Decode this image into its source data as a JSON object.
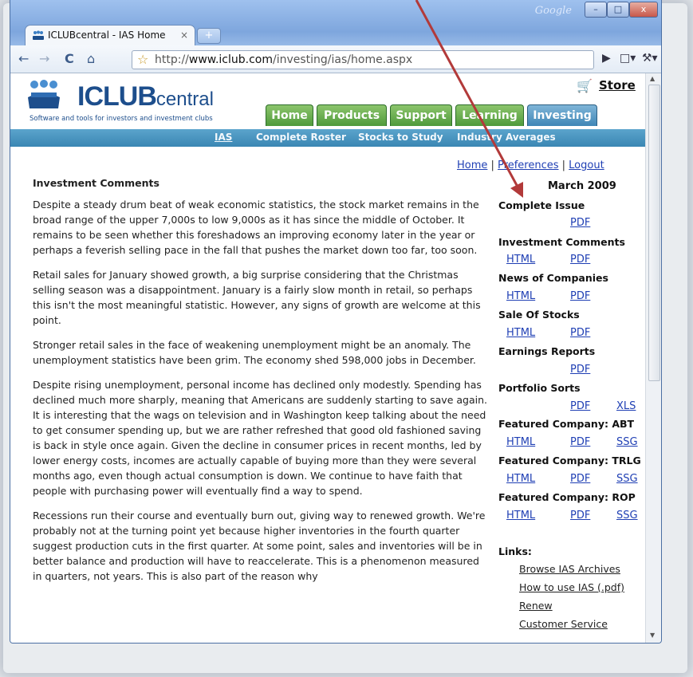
{
  "browser": {
    "watermark": "Google",
    "window_buttons": {
      "minimize": "–",
      "maximize": "□",
      "close": "x"
    },
    "tab": {
      "title": "ICLUBcentral - IAS Home",
      "close": "×",
      "favicon": "iclub-favicon-icon"
    },
    "new_tab": "+",
    "url_prefix": "http://",
    "url_domain": "www.iclub.com",
    "url_path": "/investing/ias/home.aspx",
    "nav_icons": [
      "back-icon",
      "forward-icon",
      "reload-icon",
      "home-icon",
      "bookmark-star-icon",
      "go-icon",
      "page-menu-icon",
      "wrench-menu-icon"
    ]
  },
  "site": {
    "logo_bold": "ICLUB",
    "logo_rest": "central",
    "tagline": "Software and tools for investors and investment clubs",
    "store": "Store",
    "nav_tabs": [
      "Home",
      "Products",
      "Support",
      "Learning",
      "Investing"
    ],
    "active_tab": "Investing",
    "subnav": [
      "IAS",
      "Complete Roster",
      "Stocks to Study",
      "Industry Averages"
    ],
    "toplinks": {
      "home": "Home",
      "sep1": " | ",
      "preferences": "Preferences",
      "sep2": " | ",
      "logout": "Logout"
    }
  },
  "article": {
    "heading": "Investment Comments",
    "paragraphs": [
      "Despite a steady drum beat of weak economic statistics, the stock market remains in the broad range of the upper 7,000s to low 9,000s as it has since the middle of October. It remains to be seen whether this foreshadows an improving economy later in the year or perhaps a feverish selling pace in the fall that pushes the market down too far, too soon.",
      "Retail sales for January showed growth, a big surprise considering that the Christmas selling season was a disappointment. January is a fairly slow month in retail, so perhaps this isn't the most meaningful statistic. However, any signs of growth are welcome at this point.",
      "Stronger retail sales in the face of weakening unemployment might be an anomaly. The unemployment statistics have been grim. The economy shed 598,000 jobs in December.",
      "Despite rising unemployment, personal income has declined only modestly. Spending has declined much more sharply, meaning that Americans are suddenly starting to save again. It is interesting that the wags on television and in Washington keep talking about the need to get consumer spending up, but we are rather refreshed that good old fashioned saving is back in style once again. Given the decline in consumer prices in recent months, led by lower energy costs, incomes are actually capable of buying more than they were several months ago, even though actual consumption is down. We continue to have faith that people with purchasing power will eventually find a way to spend.",
      "Recessions run their course and eventually burn out, giving way to renewed growth. We're probably not at the turning point yet because higher inventories in the fourth quarter suggest production cuts in the first quarter. At some point, sales and inventories will be in better balance and production will have to reaccelerate. This is a phenomenon measured in quarters, not years. This is also part of the reason why"
    ]
  },
  "sidebar": {
    "month": "March 2009",
    "sections": [
      {
        "title": "Complete Issue",
        "links": [
          "",
          "PDF",
          ""
        ]
      },
      {
        "title": "Investment Comments",
        "links": [
          "HTML",
          "PDF",
          ""
        ]
      },
      {
        "title": "News of Companies",
        "links": [
          "HTML",
          "PDF",
          ""
        ]
      },
      {
        "title": "Sale Of Stocks",
        "links": [
          "HTML",
          "PDF",
          ""
        ]
      },
      {
        "title": "Earnings Reports",
        "links": [
          "",
          "PDF",
          ""
        ]
      },
      {
        "title": "Portfolio Sorts",
        "links": [
          "",
          "PDF",
          "XLS"
        ]
      },
      {
        "title": "Featured Company: ABT",
        "links": [
          "HTML",
          "PDF",
          "SSG"
        ]
      },
      {
        "title": "Featured Company: TRLG",
        "links": [
          "HTML",
          "PDF",
          "SSG"
        ]
      },
      {
        "title": "Featured Company: ROP",
        "links": [
          "HTML",
          "PDF",
          "SSG"
        ]
      }
    ],
    "links_heading": "Links:",
    "links": [
      "Browse IAS Archives",
      "How to use IAS (.pdf)",
      "Renew",
      "Customer Service"
    ]
  },
  "colors": {
    "annotation_arrow": "#b23a3a",
    "nav_green": "#5aa545",
    "nav_blue": "#3f86b6",
    "link_blue": "#1f3fb4"
  }
}
